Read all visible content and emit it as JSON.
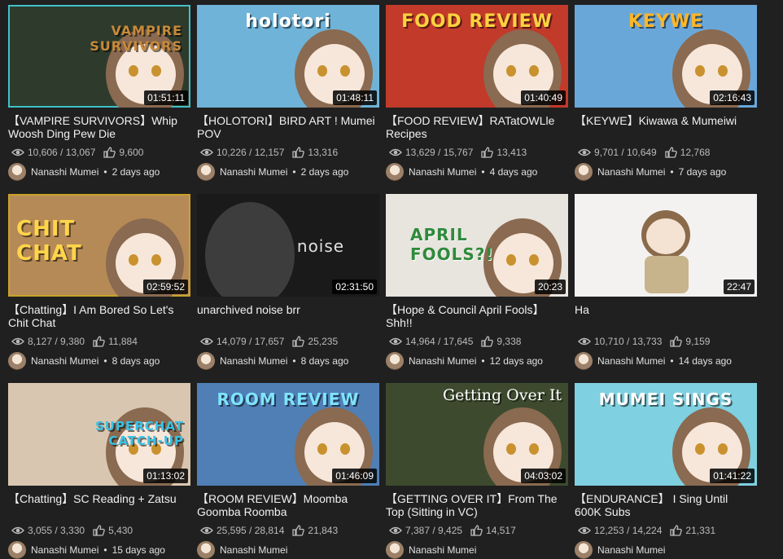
{
  "videos": [
    {
      "title": "【VAMPIRE SURVIVORS】Whip Woosh Ding Pew Die",
      "duration": "01:51:11",
      "views": "10,606 / 13,067",
      "likes": "9,600",
      "channel": "Nanashi Mumei",
      "age": "2 days ago",
      "art_text": "VAMPIRE\nSURVIVORS",
      "bg": "#2e3b2c",
      "accent": "#c88a3a"
    },
    {
      "title": "【HOLOTORI】BIRD ART ! Mumei POV",
      "duration": "01:48:11",
      "views": "10,226 / 12,157",
      "likes": "13,316",
      "channel": "Nanashi Mumei",
      "age": "2 days ago",
      "art_text": "holotori",
      "bg": "#6fb3d8",
      "accent": "#ffffff"
    },
    {
      "title": "【FOOD REVIEW】RATatOWLle Recipes",
      "duration": "01:40:49",
      "views": "13,629 / 15,767",
      "likes": "13,413",
      "channel": "Nanashi Mumei",
      "age": "4 days ago",
      "art_text": "FOOD REVIEW",
      "bg": "#c23a2a",
      "accent": "#ffd23f"
    },
    {
      "title": "【KEYWE】Kiwawa & Mumeiwi",
      "duration": "02:16:43",
      "views": "9,701 / 10,649",
      "likes": "12,768",
      "channel": "Nanashi Mumei",
      "age": "7 days ago",
      "art_text": "KEYWE",
      "bg": "#6aa7d9",
      "accent": "#ffb627"
    },
    {
      "title": "【Chatting】I Am Bored So Let's Chit Chat",
      "duration": "02:59:52",
      "views": "8,127 / 9,380",
      "likes": "11,884",
      "channel": "Nanashi Mumei",
      "age": "8 days ago",
      "art_text": "CHIT\nCHAT",
      "bg": "#b68a57",
      "accent": "#ffd54a"
    },
    {
      "title": "unarchived noise brr",
      "duration": "02:31:50",
      "views": "14,079 / 17,657",
      "likes": "25,235",
      "channel": "Nanashi Mumei",
      "age": "8 days ago",
      "art_text": "noise",
      "bg": "#1a1a1a",
      "accent": "#e0e0e0"
    },
    {
      "title": "【Hope & Council April Fools】Shh!!",
      "duration": "20:23",
      "views": "14,964 / 17,645",
      "likes": "9,338",
      "channel": "Nanashi Mumei",
      "age": "12 days ago",
      "art_text": "APRIL\nFOOLS?!",
      "bg": "#e8e4de",
      "accent": "#2f8a3c"
    },
    {
      "title": "Ha",
      "duration": "22:47",
      "views": "10,710 / 13,733",
      "likes": "9,159",
      "channel": "Nanashi Mumei",
      "age": "14 days ago",
      "art_text": "",
      "bg": "#f4f2f0",
      "accent": "#8a6a4a"
    },
    {
      "title": "【Chatting】SC Reading + Zatsu",
      "duration": "01:13:02",
      "views": "3,055 / 3,330",
      "likes": "5,430",
      "channel": "Nanashi Mumei",
      "age": "15 days ago",
      "art_text": "SUPERCHAT\nCATCH-UP",
      "bg": "#d9c6b0",
      "accent": "#39c2e6"
    },
    {
      "title": "【ROOM REVIEW】Moomba Goomba Roomba",
      "duration": "01:46:09",
      "views": "25,595 / 28,814",
      "likes": "21,843",
      "channel": "Nanashi Mumei",
      "age": "",
      "art_text": "ROOM REVIEW",
      "bg": "#4f7fb5",
      "accent": "#7fe3ff"
    },
    {
      "title": "【GETTING OVER IT】From The Top (Sitting in VC)",
      "duration": "04:03:02",
      "views": "7,387 / 9,425",
      "likes": "14,517",
      "channel": "Nanashi Mumei",
      "age": "",
      "art_text": "Getting Over It",
      "bg": "#3d4a2e",
      "accent": "#ffffff"
    },
    {
      "title": "【ENDURANCE】 I Sing Until 600K Subs",
      "duration": "01:41:22",
      "views": "12,253 / 14,224",
      "likes": "21,331",
      "channel": "Nanashi Mumei",
      "age": "",
      "art_text": "MUMEI SINGS",
      "bg": "#7fd0e0",
      "accent": "#ffffff"
    }
  ],
  "icons": {
    "views": "eye-icon",
    "likes": "thumbs-up-icon",
    "avatar": "channel-avatar"
  },
  "separator": "•"
}
